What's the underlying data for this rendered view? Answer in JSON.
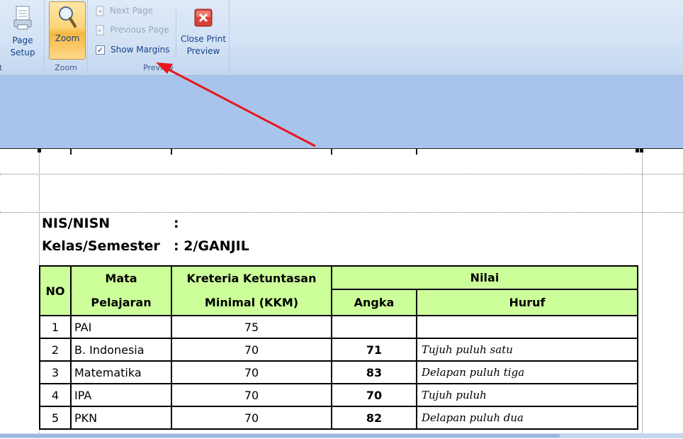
{
  "ribbon": {
    "print_group_label": "Print",
    "page_setup": {
      "line1": "Page",
      "line2": "Setup"
    },
    "zoom_button_label": "Zoom",
    "zoom_group_label": "Zoom",
    "next_page_label": "Next Page",
    "previous_page_label": "Previous Page",
    "show_margins_label": "Show Margins",
    "show_margins_checked": true,
    "close_preview": {
      "line1": "Close Print",
      "line2": "Preview"
    },
    "preview_group_label": "Preview"
  },
  "document": {
    "nis_label": "NIS/NISN",
    "nis_value": ":",
    "kelas_label": "Kelas/Semester",
    "kelas_value": ": 2/GANJIL",
    "table": {
      "headers": {
        "no": "NO",
        "mata_line1": "Mata",
        "mata_line2": "Pelajaran",
        "kkm_line1": "Kreteria Ketuntasan",
        "kkm_line2": "Minimal (KKM)",
        "nilai": "Nilai",
        "angka": "Angka",
        "huruf": "Huruf"
      },
      "rows": [
        {
          "no": "1",
          "subject": "PAI",
          "kkm": "75",
          "angka": "",
          "huruf": ""
        },
        {
          "no": "2",
          "subject": "B. Indonesia",
          "kkm": "70",
          "angka": "71",
          "huruf": "Tujuh puluh satu"
        },
        {
          "no": "3",
          "subject": "Matematika",
          "kkm": "70",
          "angka": "83",
          "huruf": "Delapan puluh tiga"
        },
        {
          "no": "4",
          "subject": "IPA",
          "kkm": "70",
          "angka": "70",
          "huruf": "Tujuh puluh"
        },
        {
          "no": "5",
          "subject": "PKN",
          "kkm": "70",
          "angka": "82",
          "huruf": "Delapan puluh dua"
        }
      ]
    }
  },
  "colors": {
    "ribbon_bg": "#d2e1f4",
    "band_bg": "#a8c4ec",
    "table_header_bg": "#ccfe99",
    "arrow": "#e8161b",
    "zoom_active": "#f7b842"
  }
}
